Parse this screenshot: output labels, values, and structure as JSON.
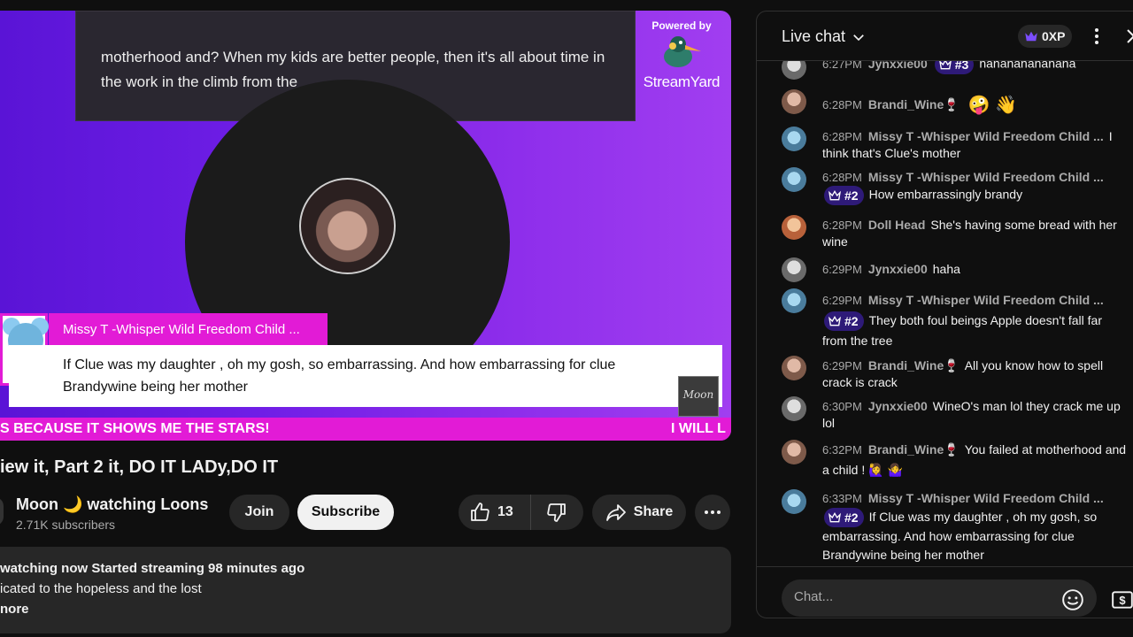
{
  "player": {
    "caption": "motherhood and? When my kids are better people, then it's all about time in the work in the climb from the",
    "powered_by": "Powered by",
    "streamyard": "StreamYard",
    "featured_name": "Missy T -Whisper Wild Freedom Child ...",
    "featured_comment": "If Clue was my daughter , oh my gosh, so embarrassing. And how embarrassing for clue Brandywine being her mother",
    "signature": "Moon",
    "ticker_left": "S BECAUSE IT SHOWS ME THE STARS!",
    "ticker_right": "I WILL L"
  },
  "video": {
    "title": "iew it, Part 2 it, DO IT LADy,DO IT",
    "channel_name": "Moon 🌙 watching Loons",
    "subscribers": "2.71K subscribers",
    "join_label": "Join",
    "subscribe_label": "Subscribe",
    "likes": "13",
    "share_label": "Share"
  },
  "description": {
    "stats": "watching now  Started streaming 98 minutes ago",
    "line": "icated to the hopeless and the lost",
    "more": "nore"
  },
  "chat": {
    "title": "Live chat",
    "xp": "0XP",
    "input_placeholder": "Chat...",
    "messages": [
      {
        "time": "6:27PM",
        "author": "Jynxxie00",
        "rank": "#3",
        "text": "hahahahahahaha",
        "avatar": "jynx"
      },
      {
        "time": "6:28PM",
        "author": "Brandi_Wine🍷",
        "rank": "",
        "text": "🤪 👋",
        "avatar": "brandi"
      },
      {
        "time": "6:28PM",
        "author": "Missy T -Whisper Wild Freedom Child ...",
        "rank": "",
        "text": "I think that's Clue's mother",
        "avatar": "missy"
      },
      {
        "time": "6:28PM",
        "author": "Missy T -Whisper Wild Freedom Child ...",
        "rank": "#2",
        "text": "How embarrassingly brandy",
        "avatar": "missy"
      },
      {
        "time": "6:28PM",
        "author": "Doll Head",
        "rank": "",
        "text": "She's having some bread with her wine",
        "avatar": "doll"
      },
      {
        "time": "6:29PM",
        "author": "Jynxxie00",
        "rank": "",
        "text": "haha",
        "avatar": "jynx"
      },
      {
        "time": "6:29PM",
        "author": "Missy T -Whisper Wild Freedom Child ...",
        "rank": "#2",
        "text": "They both foul beings Apple doesn't fall far from the tree",
        "avatar": "missy"
      },
      {
        "time": "6:29PM",
        "author": "Brandi_Wine🍷",
        "rank": "",
        "text": "All you know how to spell crack is crack",
        "avatar": "brandi"
      },
      {
        "time": "6:30PM",
        "author": "Jynxxie00",
        "rank": "",
        "text": "WineO's man lol they crack me up lol",
        "avatar": "jynx"
      },
      {
        "time": "6:32PM",
        "author": "Brandi_Wine🍷",
        "rank": "",
        "text": "You failed at motherhood and a child ! 🙋‍♀️ 🤷‍♀️",
        "avatar": "brandi"
      },
      {
        "time": "6:33PM",
        "author": "Missy T -Whisper Wild Freedom Child ...",
        "rank": "#2",
        "text": "If Clue was my daughter , oh my gosh, so embarrassing. And how embarrassing for clue Brandywine being her mother",
        "avatar": "missy"
      }
    ]
  }
}
